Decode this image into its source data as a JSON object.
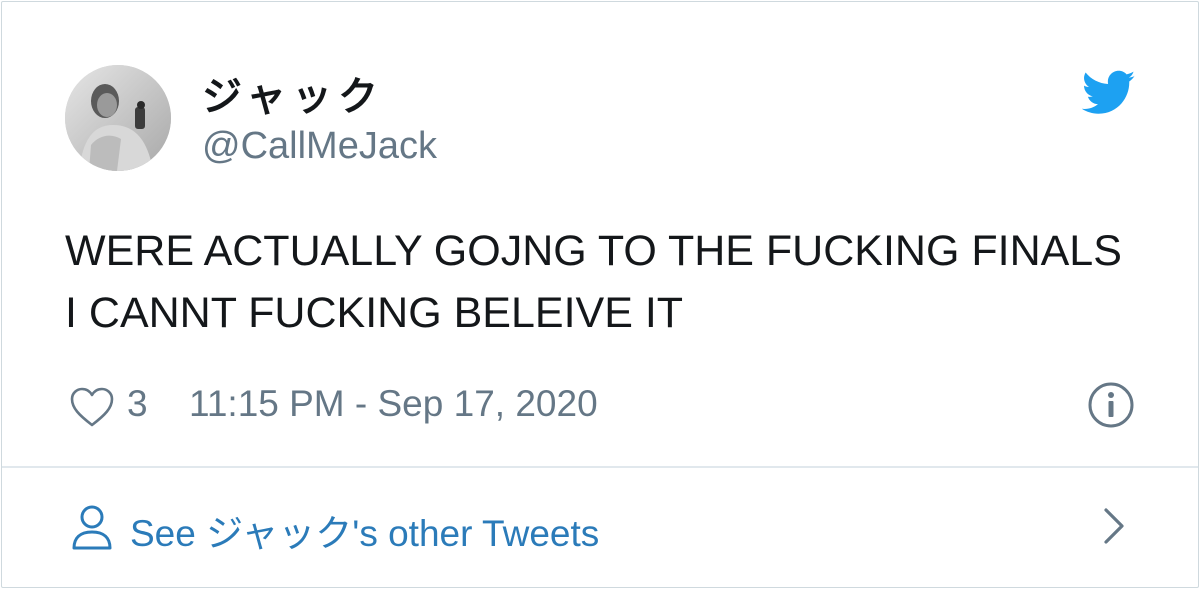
{
  "author": {
    "display_name": "ジャック",
    "handle": "@CallMeJack"
  },
  "tweet": {
    "text": "WERE ACTUALLY GOJNG TO THE FUCKING FINALS I CANNT FUCKING BELEIVE IT",
    "like_count": "3",
    "timestamp": "11:15 PM - Sep 17, 2020"
  },
  "footer": {
    "label": "See ジャック's other Tweets"
  },
  "icons": {
    "logo": "twitter-bird-icon",
    "like": "heart-icon",
    "info": "info-icon",
    "profile": "person-icon",
    "chevron": "chevron-right-icon"
  },
  "colors": {
    "twitter_blue": "#1da1f2",
    "link_blue": "#2b7bb9",
    "secondary_text": "#657786",
    "primary_text": "#14171a",
    "border": "#e1e8ed"
  }
}
